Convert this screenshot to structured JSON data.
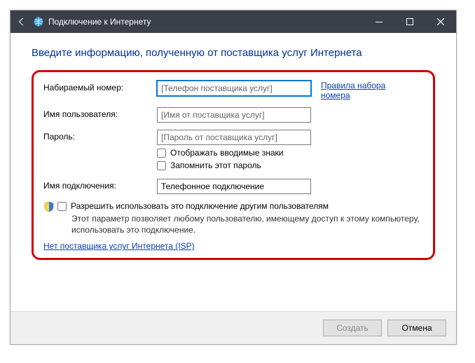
{
  "window": {
    "title": "Подключение к Интернету"
  },
  "heading": "Введите информацию, полученную от поставщика услуг Интернета",
  "form": {
    "dial_label": "Набираемый номер:",
    "dial_placeholder": "[Телефон поставщика услуг]",
    "rules_link": "Правила набора номера",
    "user_label": "Имя пользователя:",
    "user_placeholder": "[Имя от поставщика услуг]",
    "pass_label": "Пароль:",
    "pass_placeholder": "[Пароль от поставщика услуг]",
    "show_chars": "Отображать вводимые знаки",
    "remember": "Запомнить этот пароль",
    "conn_label": "Имя подключения:",
    "conn_value": "Телефонное подключение",
    "allow_label": "Разрешить использовать это подключение другим пользователям",
    "allow_desc": "Этот параметр позволяет любому пользователю, имеющему доступ к этому компьютеру, использовать это подключение.",
    "no_isp": "Нет поставщика услуг Интернета (ISP)"
  },
  "buttons": {
    "create": "Создать",
    "cancel": "Отмена"
  }
}
